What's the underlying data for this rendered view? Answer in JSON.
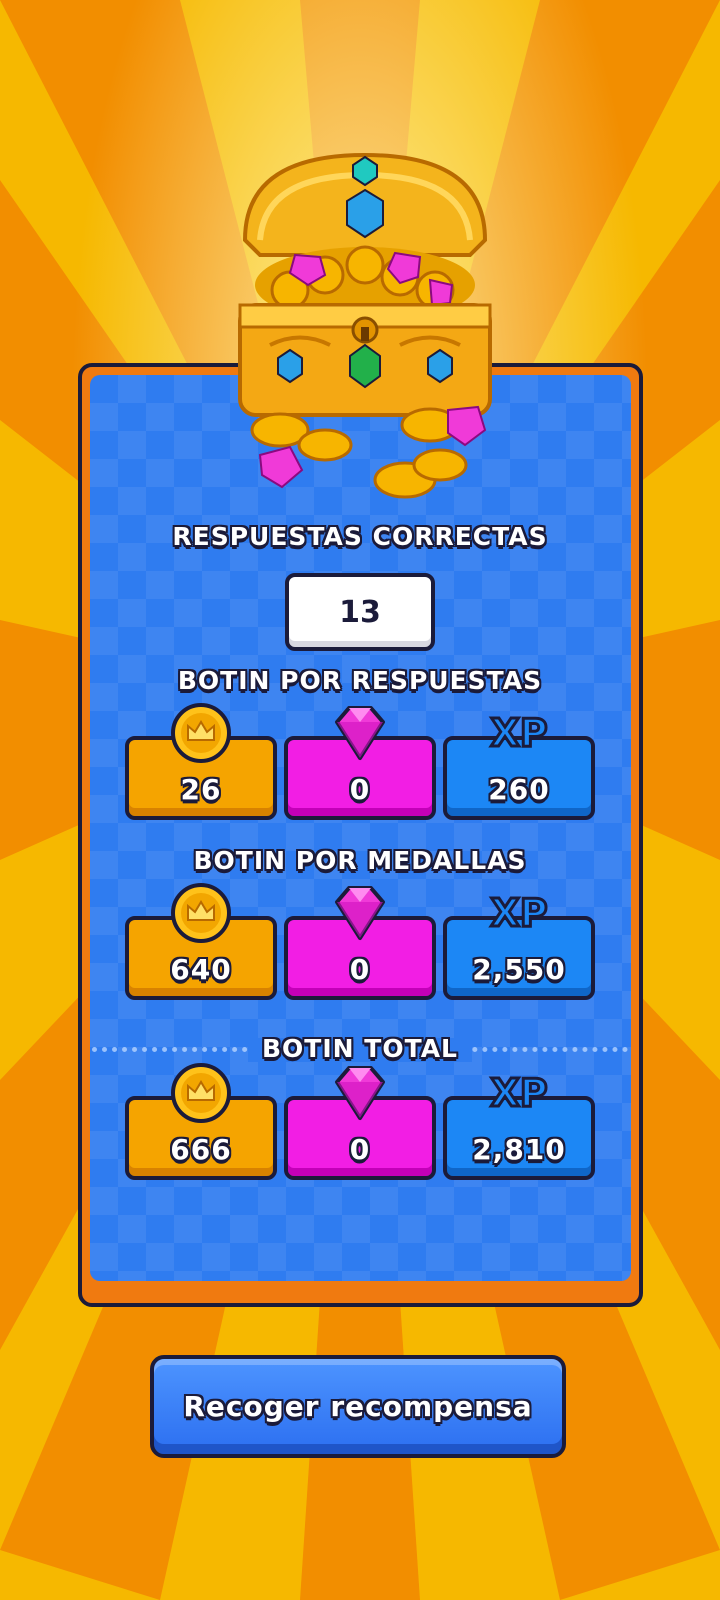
{
  "colors": {
    "background_primary": "#f6b800",
    "background_rays": "#f28a00",
    "panel_blue": "#2f7cf0",
    "panel_border": "#f07a10",
    "gold": "#f5a400",
    "gem": "#f21ee4",
    "xp": "#1c87f5",
    "button_blue": "#2c6ff0"
  },
  "correct_answers": {
    "title": "RESPUESTAS CORRECTAS",
    "value": "13"
  },
  "loot_answers": {
    "title": "BOTIN POR RESPUESTAS",
    "gold": "26",
    "gems": "0",
    "xp": "260"
  },
  "loot_medals": {
    "title": "BOTIN POR MEDALLAS",
    "gold": "640",
    "gems": "0",
    "xp": "2,550"
  },
  "loot_total": {
    "title": "BOTIN TOTAL",
    "gold": "666",
    "gems": "0",
    "xp": "2,810"
  },
  "icons": {
    "gold": "crown-coin-icon",
    "gems": "pink-gem-icon",
    "xp": "xp-icon",
    "xp_label": "XP",
    "chest": "treasure-chest-icon"
  },
  "collect_button": {
    "label": "Recoger recompensa"
  }
}
